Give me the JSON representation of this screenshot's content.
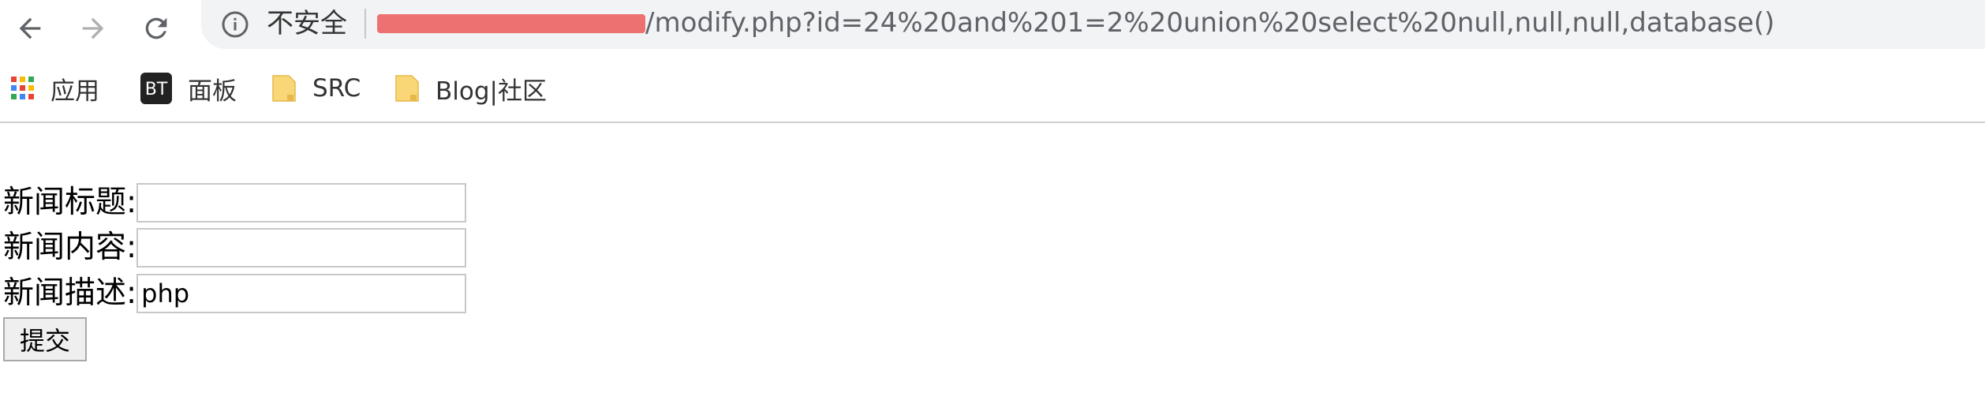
{
  "browser": {
    "back_icon": "arrow-left-icon",
    "forward_icon": "arrow-right-icon",
    "reload_icon": "reload-icon",
    "address_bar": {
      "security_icon": "info-icon",
      "security_label": "不安全",
      "url_visible": "/modify.php?id=24%20and%201=2%20union%20select%20null,null,null,database()"
    },
    "bookmarks": [
      {
        "label": "应用",
        "icon": "apps-grid-icon"
      },
      {
        "label": "面板",
        "icon": "bt-logo-icon",
        "icon_text": "BT"
      },
      {
        "label": "SRC",
        "icon": "folder-icon"
      },
      {
        "label": "Blog|社区",
        "icon": "folder-icon"
      }
    ]
  },
  "form": {
    "title_label": "新闻标题:",
    "title_value": "",
    "content_label": "新闻内容:",
    "content_value": "",
    "desc_label": "新闻描述:",
    "desc_value": "php",
    "submit_label": "提交"
  },
  "colors": {
    "address_bar_bg": "#f1f3f4",
    "redaction": "#ee6666",
    "url_text": "#5f6368",
    "folder": "#f9d776"
  }
}
